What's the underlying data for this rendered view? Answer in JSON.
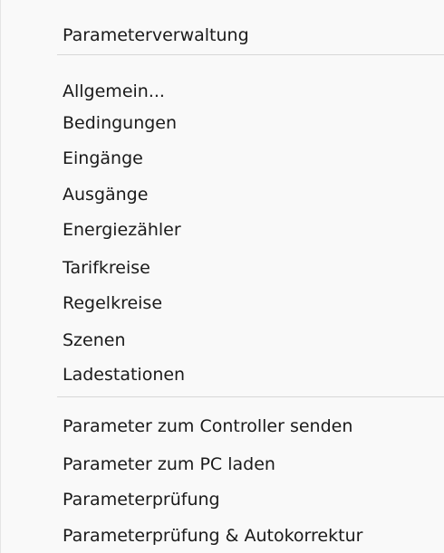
{
  "menu": {
    "header": "Parameterverwaltung",
    "general": "Allgemein...",
    "conditions": "Bedingungen",
    "inputs": "Eingänge",
    "outputs": "Ausgänge",
    "energy_meters": "Energiezähler",
    "tariff_circuits": "Tarifkreise",
    "control_loops": "Regelkreise",
    "scenes": "Szenen",
    "charging_stations": "Ladestationen",
    "send_to_controller": "Parameter zum Controller senden",
    "load_to_pc": "Parameter zum PC laden",
    "parameter_check": "Parameterprüfung",
    "parameter_check_autocorrect": "Parameterprüfung & Autokorrektur"
  }
}
